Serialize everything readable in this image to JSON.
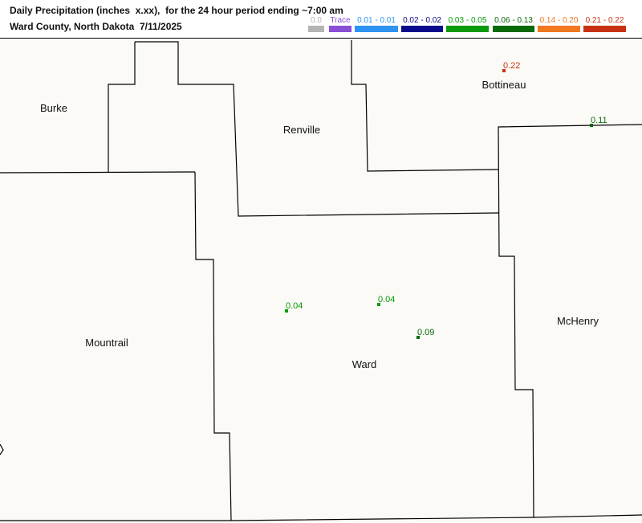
{
  "header": {
    "title_line1": "Daily Precipitation (inches  x.xx),  for the 24 hour period ending ~7:00 am",
    "title_line2": "Ward County, North Dakota  7/11/2025"
  },
  "legend": [
    {
      "label": "0.0",
      "color": "#b4b4b4",
      "text_color": "#b4b4b4"
    },
    {
      "label": "Trace",
      "color": "#8a4fd6",
      "text_color": "#8a4fd6"
    },
    {
      "label": "0.01 - 0.01",
      "color": "#2f93f2",
      "text_color": "#2f93f2"
    },
    {
      "label": "0.02 - 0.02",
      "color": "#0a0a8c",
      "text_color": "#0a0a8c"
    },
    {
      "label": "0.03 - 0.05",
      "color": "#0a9a0a",
      "text_color": "#0a9a0a"
    },
    {
      "label": "0.06 - 0.13",
      "color": "#0b6a0b",
      "text_color": "#0b6a0b"
    },
    {
      "label": "0.14 - 0.20",
      "color": "#f07820",
      "text_color": "#f07820"
    },
    {
      "label": "0.21 - 0.22",
      "color": "#c83214",
      "text_color": "#c83214"
    }
  ],
  "counties": [
    {
      "name": "Burke"
    },
    {
      "name": "Renville"
    },
    {
      "name": "Bottineau"
    },
    {
      "name": "Mountrail"
    },
    {
      "name": "Ward"
    },
    {
      "name": "McHenry"
    }
  ],
  "stations": [
    {
      "value": "0.22",
      "color": "#c83214"
    },
    {
      "value": "0.11",
      "color": "#0b6a0b"
    },
    {
      "value": "0.04",
      "color": "#0a9a0a"
    },
    {
      "value": "0.04",
      "color": "#0a9a0a"
    },
    {
      "value": "0.09",
      "color": "#0b6a0b"
    }
  ]
}
